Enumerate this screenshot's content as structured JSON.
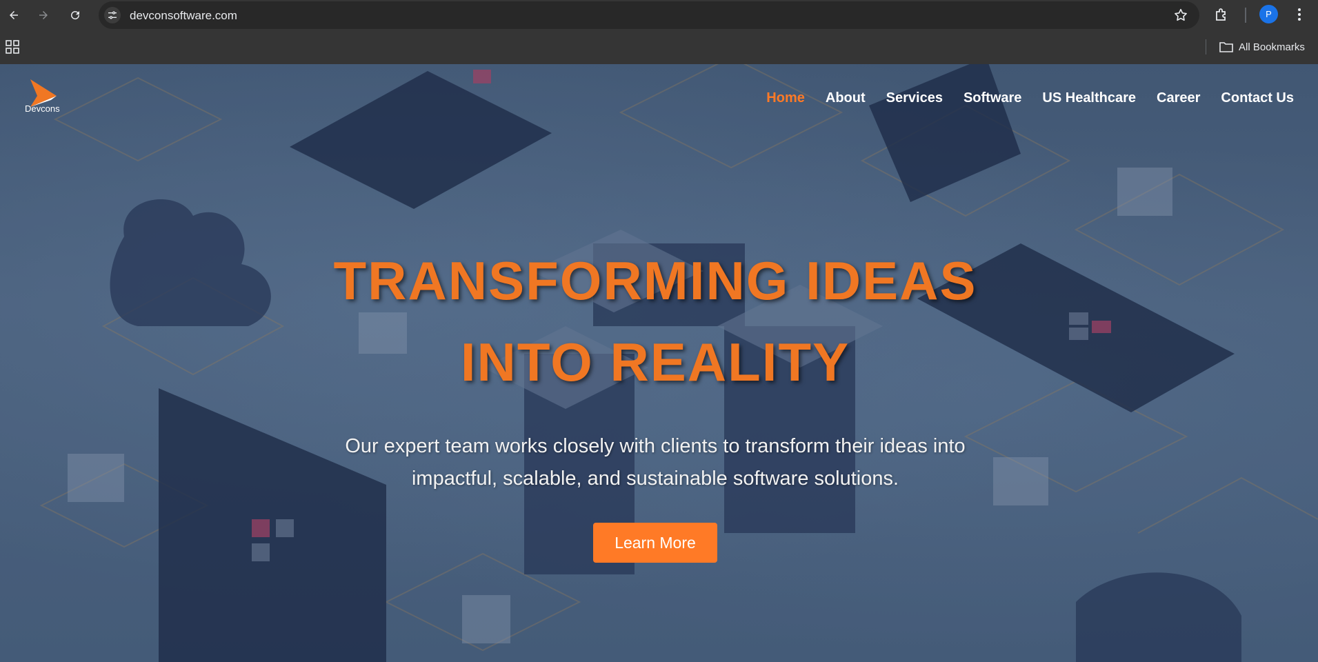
{
  "browser": {
    "url": "devconsoftware.com",
    "profile_initial": "P",
    "bookmarks_label": "All Bookmarks"
  },
  "site": {
    "logo_text": "Devcons",
    "nav": [
      {
        "label": "Home",
        "active": true
      },
      {
        "label": "About"
      },
      {
        "label": "Services"
      },
      {
        "label": "Software"
      },
      {
        "label": "US Healthcare"
      },
      {
        "label": "Career"
      },
      {
        "label": "Contact Us"
      }
    ],
    "hero": {
      "title_line1": "TRANSFORMING IDEAS",
      "title_line2": "INTO REALITY",
      "subtitle": "Our expert team works closely with clients to transform their ideas into impactful, scalable, and sustainable software solutions.",
      "cta": "Learn More"
    }
  },
  "colors": {
    "accent": "#ff7a26",
    "chrome_bg": "#353535",
    "omnibox_bg": "#282828",
    "avatar": "#1a73e8"
  }
}
